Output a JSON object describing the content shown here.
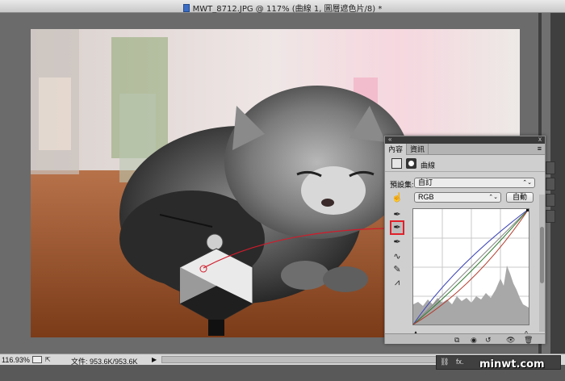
{
  "window": {
    "title": "MWT_8712.JPG @ 117% (曲線 1, 圖層遮色片/8) *"
  },
  "status": {
    "zoom": "116.93%",
    "file_info": "文件: 953.6K/953.6K"
  },
  "panel": {
    "tabs": [
      "內容",
      "資訊"
    ],
    "adjustment_label": "曲線",
    "preset_label": "預設集:",
    "preset_value": "自訂",
    "channel_value": "RGB",
    "auto_button": "自動"
  },
  "watermark": "minwt.com",
  "colors": {
    "panel_bg": "#cfcfcf",
    "highlight": "#e0202a"
  },
  "icons": [
    "doc-icon",
    "curve-adjust-icon",
    "mask-icon",
    "hand-target-icon",
    "eyedropper-black-icon",
    "eyedropper-gray-icon",
    "eyedropper-white-icon",
    "curve-point-icon",
    "pencil-icon",
    "smooth-icon",
    "clip-icon",
    "eye-icon",
    "reset-icon",
    "visibility-icon",
    "trash-icon",
    "link-icon",
    "fx-icon"
  ]
}
